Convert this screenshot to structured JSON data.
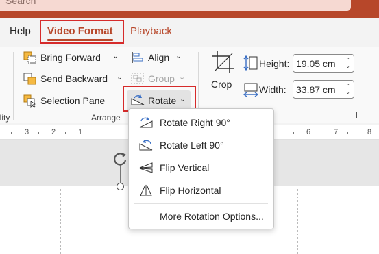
{
  "search": {
    "placeholder": "Search"
  },
  "tabs": [
    {
      "label": "Help"
    },
    {
      "label": "Video Format"
    },
    {
      "label": "Playback"
    }
  ],
  "ribbon": {
    "left_cut_label": "ility",
    "bring_forward": "Bring Forward",
    "send_backward": "Send Backward",
    "selection_pane": "Selection Pane",
    "align": "Align",
    "group": "Group",
    "rotate": "Rotate",
    "arrange_label": "Arrange",
    "crop": "Crop",
    "height_label": "Height:",
    "height_value": "19.05 cm",
    "width_label": "Width:",
    "width_value": "33.87 cm"
  },
  "ruler": {
    "numbers": [
      {
        "label": "3"
      },
      {
        "label": "2"
      },
      {
        "label": "1"
      },
      {
        "label": "6"
      },
      {
        "label": "7"
      },
      {
        "label": "8"
      }
    ]
  },
  "rotate_menu": {
    "items": [
      {
        "label": "Rotate Right 90°",
        "icon": "rotate-right-icon"
      },
      {
        "label": "Rotate Left 90°",
        "icon": "rotate-left-icon"
      },
      {
        "label": "Flip Vertical",
        "icon": "flip-vertical-icon"
      },
      {
        "label": "Flip Horizontal",
        "icon": "flip-horizontal-icon"
      },
      {
        "label": "More Rotation Options...",
        "icon": ""
      }
    ]
  },
  "colors": {
    "accent": "#b7472a",
    "highlight_box": "#d62b2b",
    "ribbon_bg": "#f3f3f3"
  }
}
